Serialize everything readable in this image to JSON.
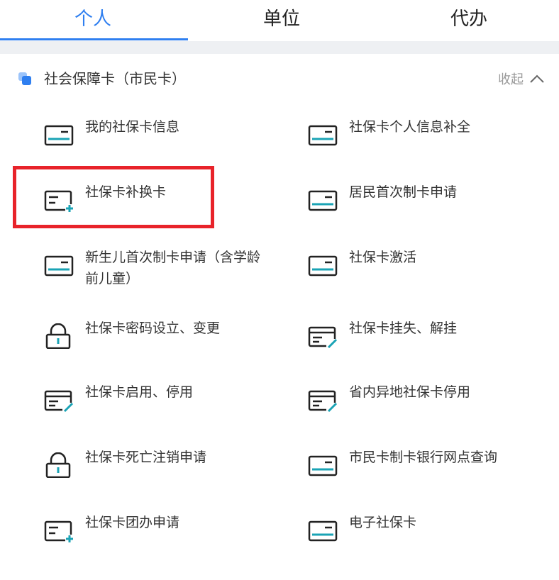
{
  "tabs": [
    {
      "label": "个人",
      "active": true
    },
    {
      "label": "单位",
      "active": false
    },
    {
      "label": "代办",
      "active": false
    }
  ],
  "section": {
    "title": "社会保障卡（市民卡）",
    "collapse_label": "收起"
  },
  "services": [
    {
      "label": "我的社保卡信息",
      "icon": "card-icon"
    },
    {
      "label": "社保卡个人信息补全",
      "icon": "card-icon"
    },
    {
      "label": "社保卡补换卡",
      "icon": "card-add-icon"
    },
    {
      "label": "居民首次制卡申请",
      "icon": "card-icon"
    },
    {
      "label": "新生儿首次制卡申请（含学龄前儿童）",
      "icon": "card-icon"
    },
    {
      "label": "社保卡激活",
      "icon": "card-icon"
    },
    {
      "label": "社保卡密码设立、变更",
      "icon": "lock-icon"
    },
    {
      "label": "社保卡挂失、解挂",
      "icon": "card-edit-icon"
    },
    {
      "label": "社保卡启用、停用",
      "icon": "card-edit-icon"
    },
    {
      "label": "省内异地社保卡停用",
      "icon": "card-edit-icon"
    },
    {
      "label": "社保卡死亡注销申请",
      "icon": "lock-icon"
    },
    {
      "label": "市民卡制卡银行网点查询",
      "icon": "card-icon"
    },
    {
      "label": "社保卡团办申请",
      "icon": "card-add-icon"
    },
    {
      "label": "电子社保卡",
      "icon": "card-icon"
    }
  ],
  "colors": {
    "accent": "#2f7ff0",
    "icon_teal": "#1aa3b5",
    "highlight": "#e8232a",
    "divider_bg": "#eef0f3"
  }
}
